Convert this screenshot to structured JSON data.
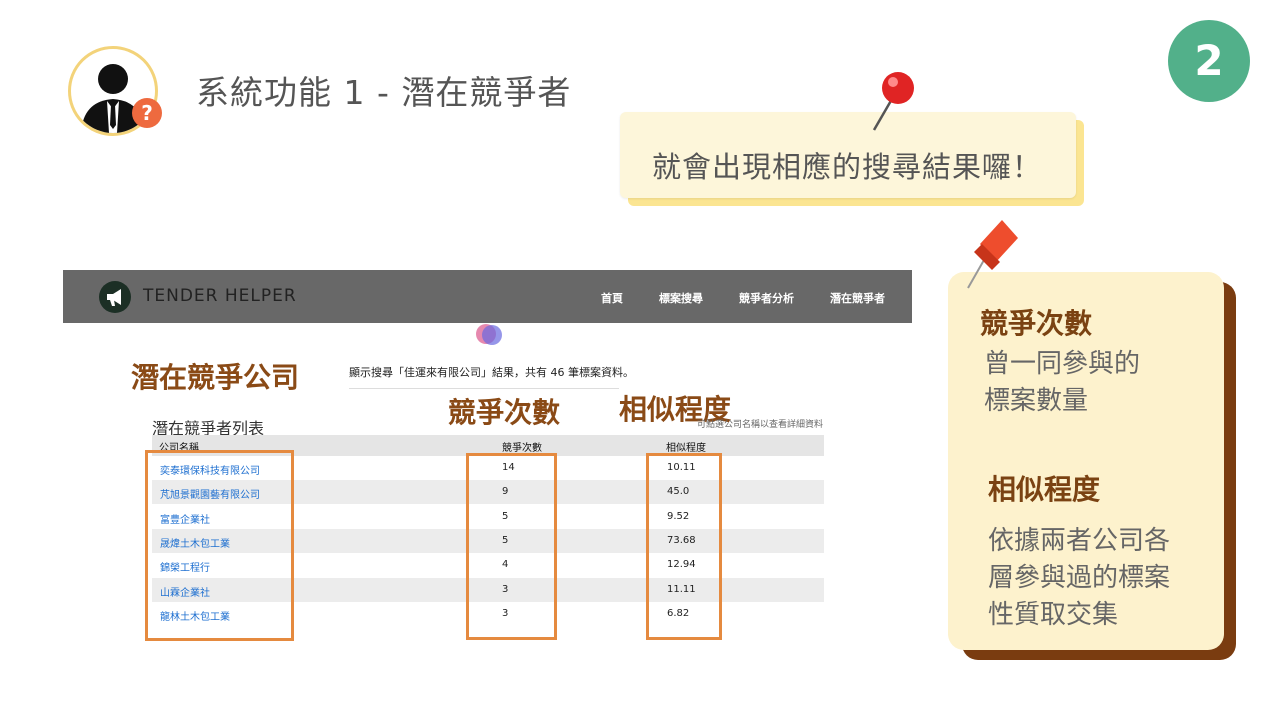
{
  "slide": {
    "title": "系統功能 1 - 潛在競爭者",
    "number": "2",
    "avatar_badge": "?",
    "note_top": "就會出現相應的搜尋結果囉！"
  },
  "side_note": {
    "heading1": "競爭次數",
    "body1": [
      "曾一同參與的",
      "標案數量"
    ],
    "heading2": "相似程度",
    "body2": [
      "依據兩者公司各",
      "層參與過的標案",
      "性質取交集"
    ]
  },
  "callouts": {
    "companies": "潛在競爭公司",
    "count": "競爭次數",
    "similarity": "相似程度"
  },
  "app": {
    "brand": "TENDER HELPER",
    "nav": [
      "首頁",
      "標案搜尋",
      "競爭者分析",
      "潛在競爭者"
    ],
    "result_text": "顯示搜尋「佳運來有限公司」結果，共有 46 筆標案資料。",
    "list_title": "潛在競爭者列表",
    "hint": "可點選公司名稱以查看詳細資料",
    "columns": [
      "公司名稱",
      "競爭次數",
      "相似程度"
    ],
    "rows": [
      {
        "name": "奕泰環保科技有限公司",
        "count": "14",
        "similarity": "10.11"
      },
      {
        "name": "芃旭景觀園藝有限公司",
        "count": "9",
        "similarity": "45.0"
      },
      {
        "name": "富豊企業社",
        "count": "5",
        "similarity": "9.52"
      },
      {
        "name": "晟煒土木包工業",
        "count": "5",
        "similarity": "73.68"
      },
      {
        "name": "錦榮工程行",
        "count": "4",
        "similarity": "12.94"
      },
      {
        "name": "山霖企業社",
        "count": "3",
        "similarity": "11.11"
      },
      {
        "name": "龍林土木包工業",
        "count": "3",
        "similarity": "6.82"
      }
    ]
  },
  "colors": {
    "accent_green": "#52b08a",
    "note_yellow": "#fdf2cd",
    "note_brown": "#7a3c10",
    "highlight_orange": "#e58a3f",
    "navbar_gray": "#686868",
    "link_blue": "#1e6fd0"
  },
  "icons": [
    "user-silhouette-icon",
    "question-badge-icon",
    "red-pin-icon",
    "pushpin-icon",
    "megaphone-logo-icon"
  ]
}
